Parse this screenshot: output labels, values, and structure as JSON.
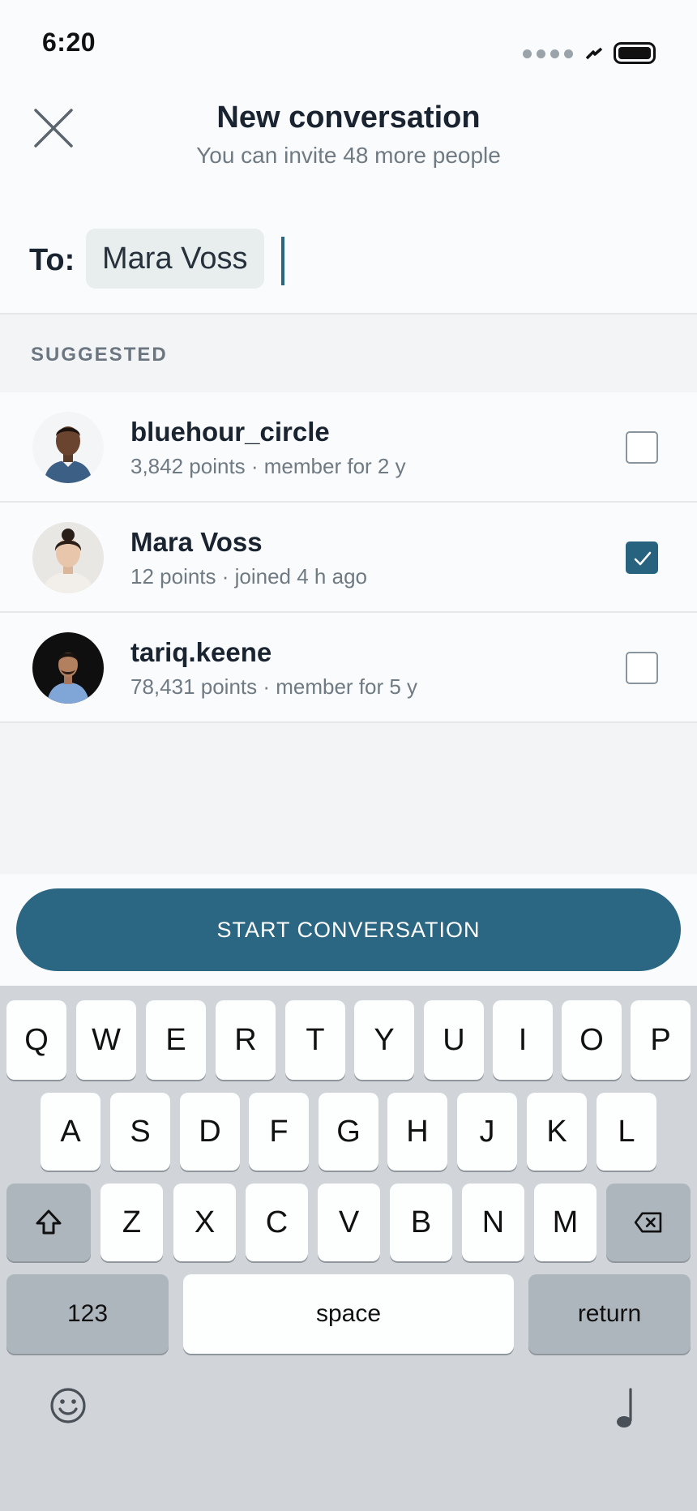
{
  "status_bar": {
    "time": "6:20"
  },
  "header": {
    "title": "New conversation",
    "subtitle": "You can invite 48 more people"
  },
  "to_field": {
    "label": "To:",
    "selected_recipient": "Mara Voss"
  },
  "suggested": {
    "label": "SUGGESTED",
    "users": [
      {
        "name": "bluehour_circle",
        "meta": "3,842 points · member for 2 y",
        "checked": false
      },
      {
        "name": "Mara Voss",
        "meta": "12 points · joined 4 h ago",
        "checked": true
      },
      {
        "name": "tariq.keene",
        "meta": "78,431 points · member for 5 y",
        "checked": false
      }
    ]
  },
  "actions": {
    "start_label": "START CONVERSATION"
  },
  "keyboard": {
    "row1": [
      "Q",
      "W",
      "E",
      "R",
      "T",
      "Y",
      "U",
      "I",
      "O",
      "P"
    ],
    "row2": [
      "A",
      "S",
      "D",
      "F",
      "G",
      "H",
      "J",
      "K",
      "L"
    ],
    "row3": [
      "Z",
      "X",
      "C",
      "V",
      "B",
      "N",
      "M"
    ],
    "numbers_label": "123",
    "space_label": "space",
    "return_label": "return",
    "icons": [
      "shift-icon",
      "backspace-icon",
      "emoji-icon",
      "dictation-icon"
    ]
  },
  "colors": {
    "accent": "#2b6783",
    "checkbox_checked": "#27627f",
    "background": "#f9fbfc",
    "section_bg": "#f2f4f6",
    "keyboard_bg": "#d1d5da"
  }
}
